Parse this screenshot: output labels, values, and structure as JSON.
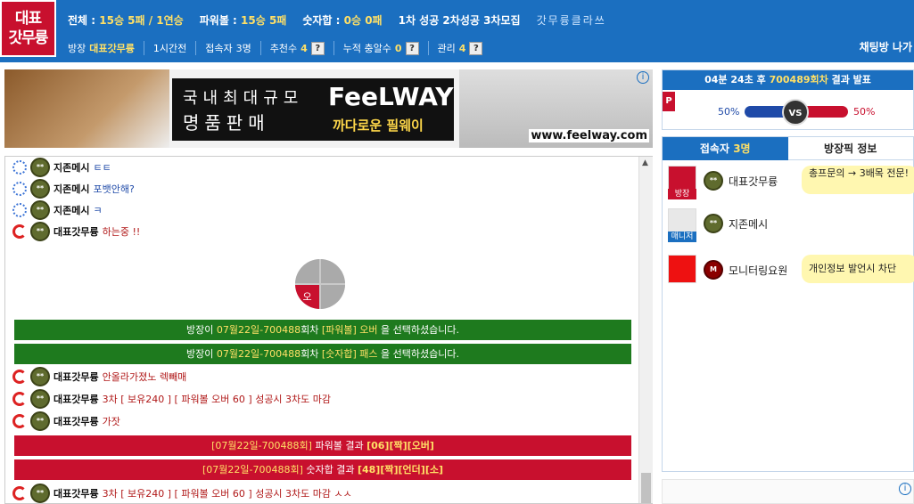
{
  "header": {
    "logo_text_1": "대표",
    "logo_text_2": "갓무륭",
    "stats": [
      {
        "label": "전체 :",
        "value": "15승 5패 / 1연승"
      },
      {
        "label": "파워볼 :",
        "value": "15승 5패"
      },
      {
        "label": "숫자합 :",
        "value": "0승 0패"
      }
    ],
    "promo": "1차 성공 2차성공 3차모집",
    "club": "갓무륭클라쓰",
    "room_label": "방장",
    "room_owner": "대표갓무륭",
    "time_range": "1시간전",
    "users_label": "접속자",
    "users_value": "3명",
    "recommend_label": "추천수",
    "recommend_value": "4",
    "gift_label": "누적 충알수",
    "gift_value": "0",
    "manage_label": "관리",
    "manage_value": "4",
    "q_mark": "?",
    "chatroom_button": "채팅방 나가"
  },
  "ad_top": {
    "line1": "국내최대규모",
    "line2": "명품판매",
    "brand": "FeeLWAY",
    "sub": "까다로운 필웨이",
    "url": "www.feelway.com",
    "info": "i"
  },
  "chat": {
    "messages_a": [
      {
        "icon": "gear",
        "nick": "지존메시",
        "text": "ㅌㅌ",
        "color": "blue"
      },
      {
        "icon": "gear",
        "nick": "지존메시",
        "text": "포뱃안해?",
        "color": "blue"
      },
      {
        "icon": "gear",
        "nick": "지존메시",
        "text": "ㅋ",
        "color": "blue"
      },
      {
        "icon": "swirl",
        "nick": "대표갓무륭",
        "text": "하는중 !!",
        "color": "red"
      }
    ],
    "pie_label": "오",
    "bar_green_1": {
      "pre": "방장이 ",
      "date": "07월22일-700488",
      "mid": "회차 ",
      "pick": "[파워볼] 오버",
      "post": " 을 선택하셨습니다."
    },
    "bar_green_2": {
      "pre": "방장이 ",
      "date": "07월22일-700488",
      "mid": "회차 ",
      "pick": "[숫자합] 패스",
      "post": " 을 선택하셨습니다."
    },
    "messages_b": [
      {
        "icon": "swirl",
        "nick": "대표갓무륭",
        "text": "안올라가졌노 렉빼매",
        "color": "red"
      },
      {
        "icon": "swirl",
        "nick": "대표갓무륭",
        "text": "3차 [ 보유240 ] [ 파워볼 오버 60 ] 성공시 3차도 마감",
        "color": "red"
      },
      {
        "icon": "swirl",
        "nick": "대표갓무륭",
        "text": "가잣",
        "color": "red"
      }
    ],
    "bar_red_1": {
      "pre": "[07월22일-700488회] ",
      "mid": "파워볼 결과 ",
      "r1": "[06]",
      "r2": "[짝]",
      "r3": "[오버]"
    },
    "bar_red_2": {
      "pre": "[07월22일-700488회] ",
      "mid": "숫자합 결과 ",
      "r1": "[48]",
      "r2": "[짝]",
      "r3": "[언더]",
      "r4": "[소]"
    },
    "messages_c": [
      {
        "icon": "swirl",
        "nick": "대표갓무륭",
        "text": "3차 [ 보유240 ] [ 파워볼 오버 60 ] 성공시 3차도 마감 ㅅㅅ",
        "color": "red"
      }
    ],
    "scroll_up": "▲"
  },
  "vote": {
    "header_pre": "04분 24초 후 ",
    "header_round": "700489회차",
    "header_post": " 결과 발표",
    "tag": "P",
    "left_pct": "50%",
    "right_pct": "50%",
    "vs": "VS"
  },
  "users_panel": {
    "tab_users_label": "접속자 ",
    "tab_users_count": "3명",
    "tab_info": "방장픽 정보",
    "users": [
      {
        "name": "대표갓무륭",
        "badge": "방장",
        "bubble": "총프문의 → 3배목 전문!"
      },
      {
        "name": "지존메시",
        "badge": "매니저",
        "bubble": ""
      },
      {
        "name": "모니터링요원",
        "badge": "",
        "bubble": "개인정보 발언시 차단"
      }
    ]
  },
  "ad_bottom": {
    "info": "i"
  },
  "colors": {
    "primary": "#1b6fc0",
    "accent": "#ffe066",
    "red": "#c8102e",
    "green": "#1e7a1e"
  }
}
